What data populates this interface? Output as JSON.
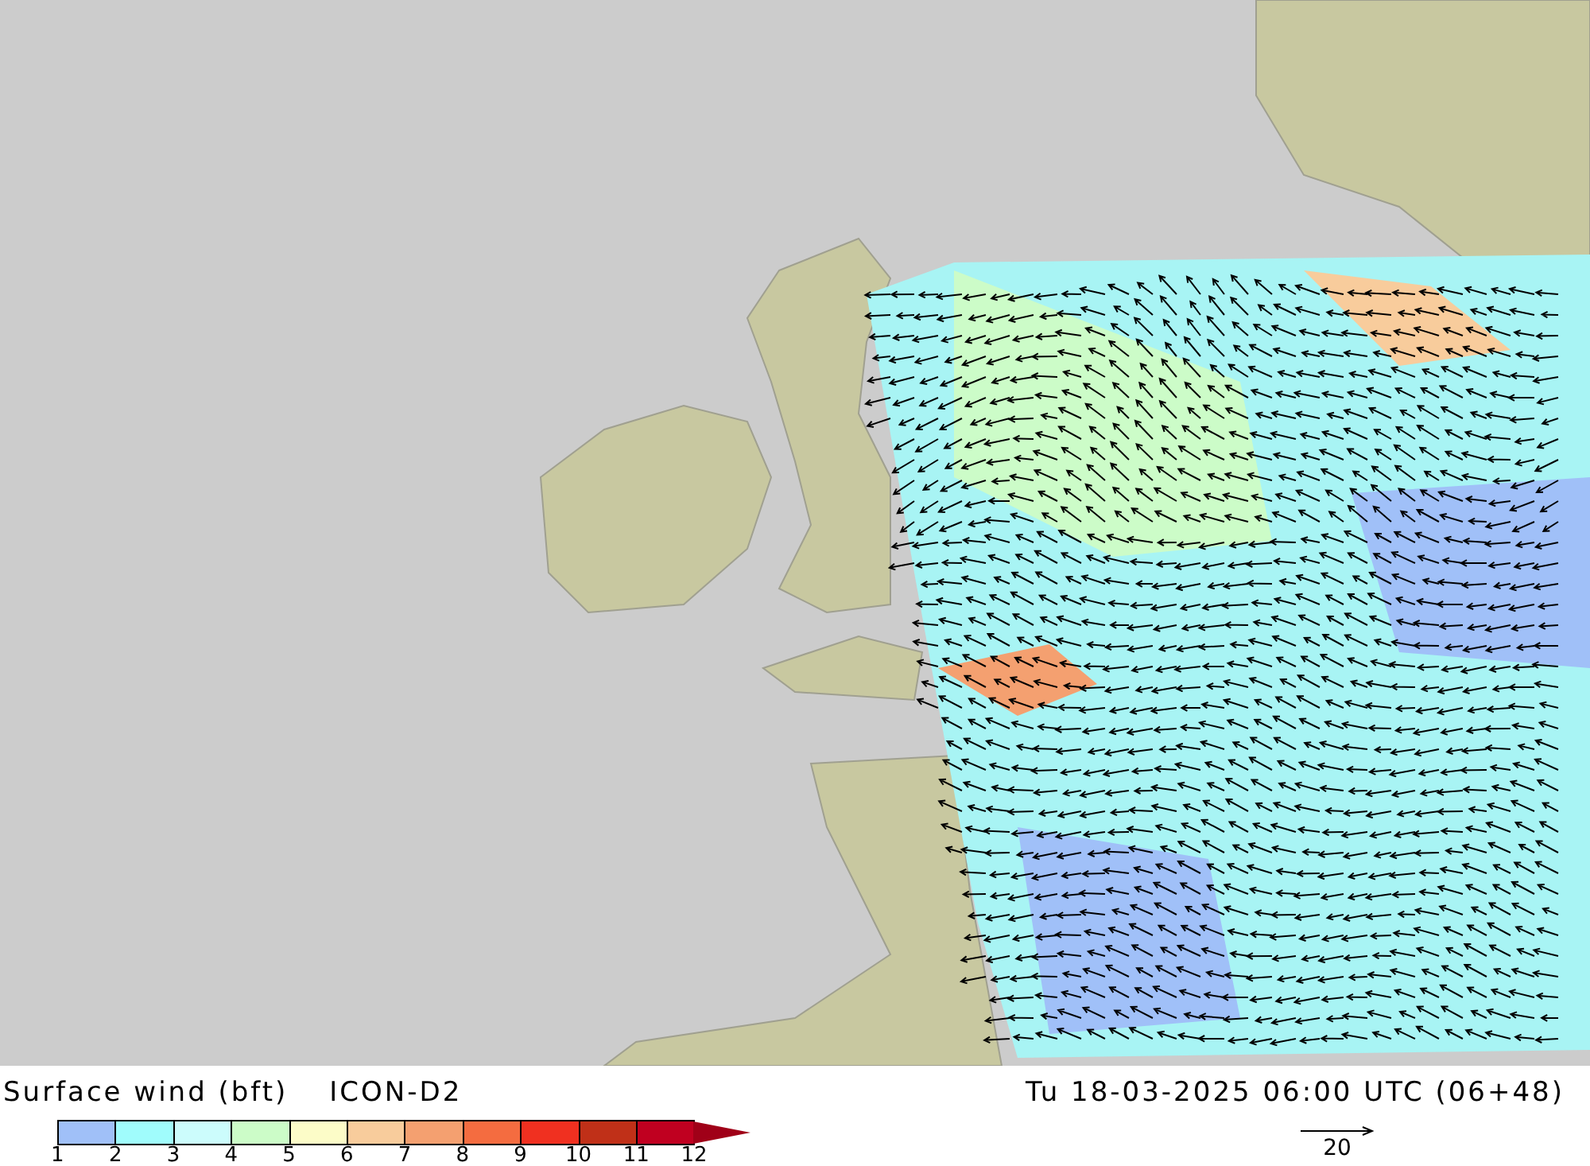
{
  "title": "Surface wind (bft)",
  "model": "ICON-D2",
  "valid_time": "Tu 18-03-2025 06:00 UTC (06+48)",
  "legend": {
    "bins": [
      {
        "color": "#a0c0f8"
      },
      {
        "color": "#a0fcfc"
      },
      {
        "color": "#ccfcfc"
      },
      {
        "color": "#ccfcc8"
      },
      {
        "color": "#fcfcc8"
      },
      {
        "color": "#f8cc9c"
      },
      {
        "color": "#f4a070"
      },
      {
        "color": "#f46c40"
      },
      {
        "color": "#f03020"
      },
      {
        "color": "#c03018"
      },
      {
        "color": "#c00020"
      }
    ],
    "overflow": {
      "color": "#a00018"
    },
    "labels": [
      "1",
      "2",
      "3",
      "4",
      "5",
      "6",
      "7",
      "8",
      "9",
      "10",
      "11",
      "12"
    ]
  },
  "reference_arrow": {
    "label": "20"
  }
}
